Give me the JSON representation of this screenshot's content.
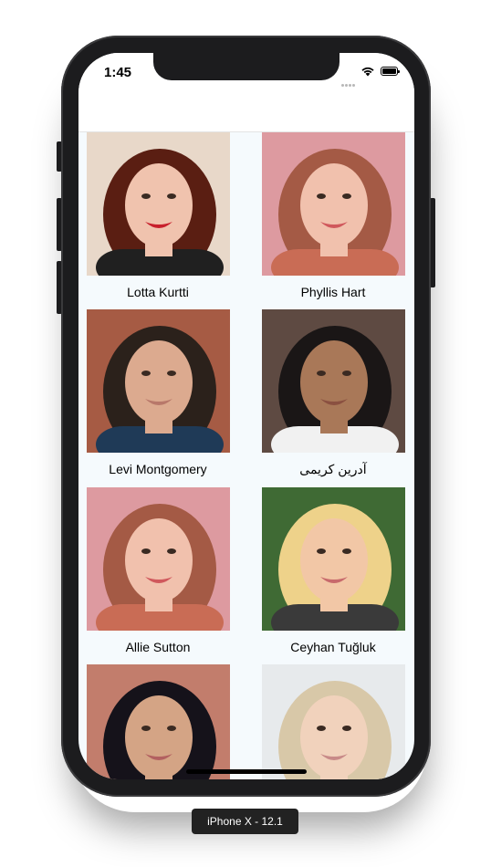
{
  "status_bar": {
    "time": "1:45"
  },
  "contacts": [
    {
      "name": "Lotta Kurtti",
      "bg": "#e8d8c9",
      "hair": "#5a1e12",
      "skin": "#f0c3ae",
      "shirt": "#202020",
      "lip": "#c8202c"
    },
    {
      "name": "Phyllis Hart",
      "bg": "#dd9aa0",
      "hair": "#a45a45",
      "skin": "#f1c1ad",
      "shirt": "#c96c55",
      "lip": "#d0585c"
    },
    {
      "name": "Levi Montgomery",
      "bg": "#a65b44",
      "hair": "#2b211b",
      "skin": "#dcaa8f",
      "shirt": "#1f3a57",
      "lip": "#b8786a"
    },
    {
      "name": "آدرین کریمی",
      "bg": "#5e4a42",
      "hair": "#1a1616",
      "skin": "#a97858",
      "shirt": "#f1f1f1",
      "lip": "#8a5040"
    },
    {
      "name": "Allie Sutton",
      "bg": "#dd9aa0",
      "hair": "#a45a45",
      "skin": "#f1c1ad",
      "shirt": "#c96c55",
      "lip": "#d0585c"
    },
    {
      "name": "Ceyhan Tuğluk",
      "bg": "#3f6a34",
      "hair": "#eed28a",
      "skin": "#f2c7a6",
      "shirt": "#3a3a3a",
      "lip": "#c86a6c"
    },
    {
      "name": "",
      "bg": "#c27d6c",
      "hair": "#15121a",
      "skin": "#d4a485",
      "shirt": "#c23a44",
      "lip": "#b26060"
    },
    {
      "name": "",
      "bg": "#e7eaec",
      "hair": "#d8c8a8",
      "skin": "#f1d2bc",
      "shirt": "#ffffff",
      "lip": "#c88a88"
    }
  ],
  "device_label": "iPhone X - 12.1"
}
